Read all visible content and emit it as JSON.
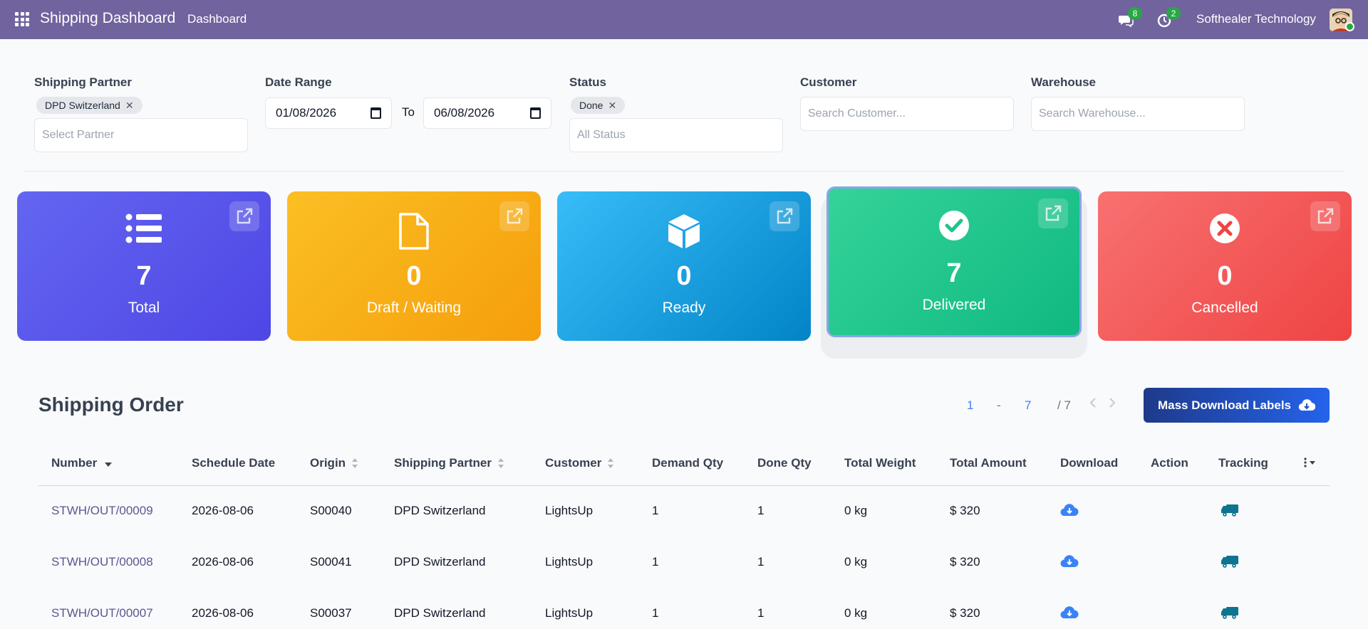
{
  "navbar": {
    "brand": "Shipping Dashboard",
    "menu": "Dashboard",
    "messages_count": "8",
    "activities_count": "2",
    "company": "Softhealer Technology",
    "color": "#71639e"
  },
  "filters": {
    "partner": {
      "label": "Shipping Partner",
      "tag": "DPD Switzerland",
      "placeholder": "Select Partner"
    },
    "date": {
      "label": "Date Range",
      "from": "01/08/2026",
      "to_label": "To",
      "to": "06/08/2026"
    },
    "status": {
      "label": "Status",
      "tag": "Done",
      "placeholder": "All Status"
    },
    "customer": {
      "label": "Customer",
      "placeholder": "Search Customer..."
    },
    "warehouse": {
      "label": "Warehouse",
      "placeholder": "Search Warehouse..."
    }
  },
  "cards": {
    "total": {
      "value": "7",
      "label": "Total",
      "icon": "list-icon"
    },
    "draft": {
      "value": "0",
      "label": "Draft / Waiting",
      "icon": "file-icon"
    },
    "ready": {
      "value": "0",
      "label": "Ready",
      "icon": "box-icon"
    },
    "delivered": {
      "value": "7",
      "label": "Delivered",
      "icon": "check-circle-icon"
    },
    "cancelled": {
      "value": "0",
      "label": "Cancelled",
      "icon": "x-circle-icon"
    }
  },
  "orders": {
    "title": "Shipping Order",
    "pager": {
      "start": "1",
      "sep": "-",
      "end": "7",
      "total": "/ 7"
    },
    "mass_download": "Mass Download Labels",
    "columns": {
      "number": "Number",
      "schedule": "Schedule Date",
      "origin": "Origin",
      "partner": "Shipping Partner",
      "customer": "Customer",
      "demand": "Demand Qty",
      "done": "Done Qty",
      "weight": "Total Weight",
      "amount": "Total Amount",
      "download": "Download",
      "action": "Action",
      "tracking": "Tracking"
    },
    "rows": [
      {
        "number": "STWH/OUT/00009",
        "schedule": "2026-08-06",
        "origin": "S00040",
        "partner": "DPD Switzerland",
        "customer": "LightsUp",
        "demand": "1",
        "done": "1",
        "weight": "0 kg",
        "amount": "$ 320"
      },
      {
        "number": "STWH/OUT/00008",
        "schedule": "2026-08-06",
        "origin": "S00041",
        "partner": "DPD Switzerland",
        "customer": "LightsUp",
        "demand": "1",
        "done": "1",
        "weight": "0 kg",
        "amount": "$ 320"
      },
      {
        "number": "STWH/OUT/00007",
        "schedule": "2026-08-06",
        "origin": "S00037",
        "partner": "DPD Switzerland",
        "customer": "LightsUp",
        "demand": "1",
        "done": "1",
        "weight": "0 kg",
        "amount": "$ 320"
      }
    ]
  }
}
